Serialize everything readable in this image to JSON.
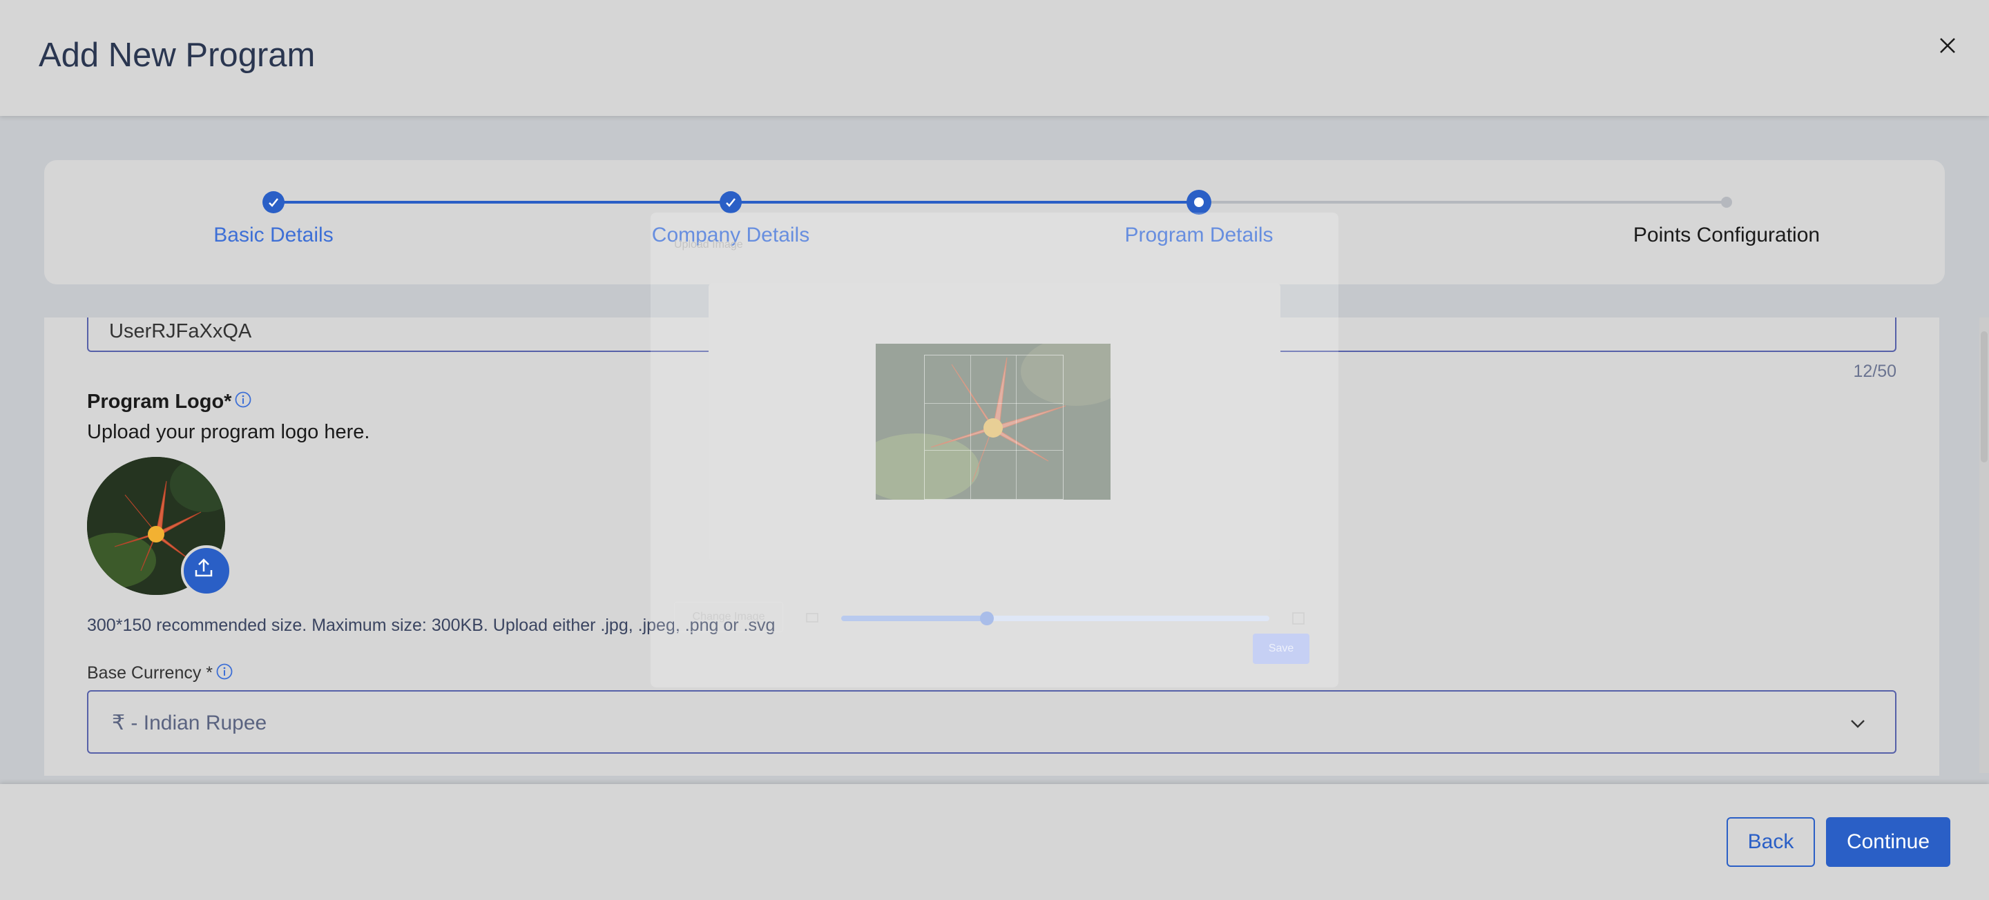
{
  "header": {
    "title": "Add New Program"
  },
  "stepper": {
    "steps": [
      {
        "label": "Basic Details",
        "status": "completed"
      },
      {
        "label": "Company Details",
        "status": "completed"
      },
      {
        "label": "Program Details",
        "status": "active"
      },
      {
        "label": "Points Configuration",
        "status": "pending"
      }
    ]
  },
  "form": {
    "program_name_value": "UserRJFaXxQA",
    "program_name_counter": "12/50",
    "logo_label": "Program Logo*",
    "logo_subtitle": "Upload your program logo here.",
    "logo_hint": "300*150 recommended size. Maximum size: 300KB. Upload either .jpg, .jpeg, .png or .svg",
    "currency_label": "Base Currency *",
    "currency_value": "₹ - Indian Rupee"
  },
  "footer": {
    "back_label": "Back",
    "continue_label": "Continue"
  },
  "modal": {
    "title": "Upload Image",
    "change_image_label": "Change Image",
    "save_label": "Save",
    "zoom_level": 0.34
  },
  "colors": {
    "primary": "#2a5fc6",
    "step_label_active": "#3d6fd6",
    "step_label_pending": "#1a1a1a",
    "line_pending": "#b5b8be"
  },
  "icons": [
    "close-icon",
    "check-icon",
    "info-icon",
    "upload-icon",
    "chevron-down-icon",
    "image-small-icon",
    "image-large-icon"
  ]
}
